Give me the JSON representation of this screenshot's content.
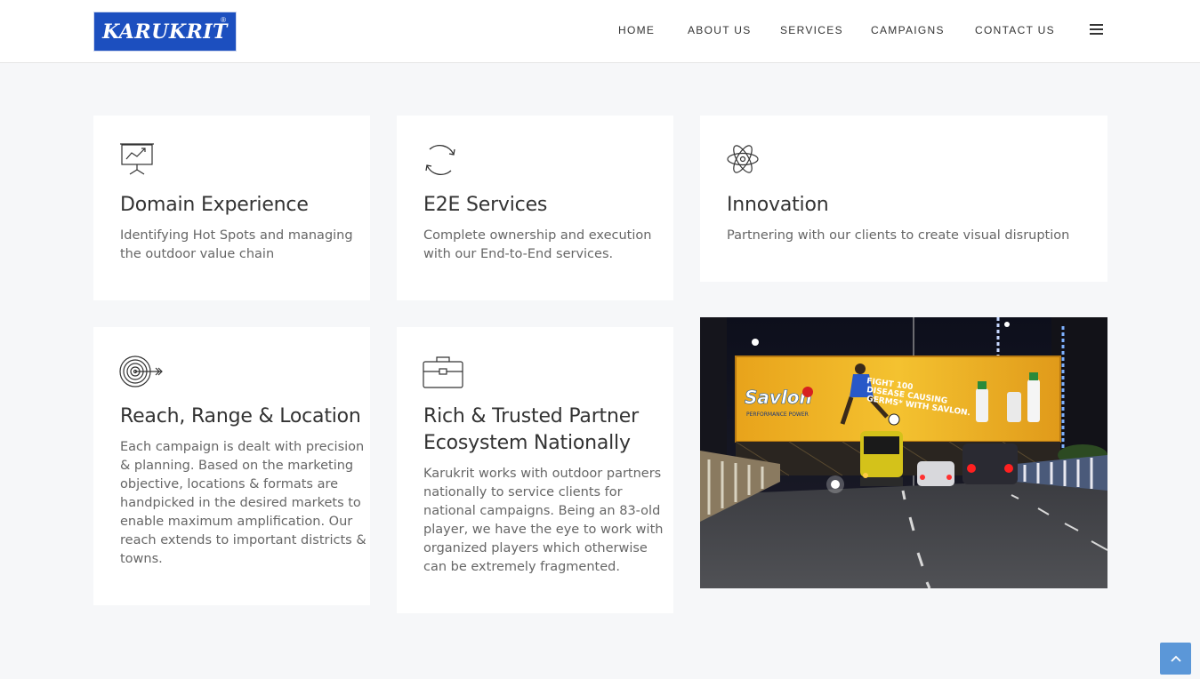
{
  "brand": {
    "logo_text": "KARUKRIT",
    "logo_mark": "®"
  },
  "nav": {
    "items": [
      {
        "label": "HOME"
      },
      {
        "label": "ABOUT US"
      },
      {
        "label": "SERVICES"
      },
      {
        "label": "CAMPAIGNS"
      },
      {
        "label": "CONTACT US"
      }
    ],
    "menu_icon": "hamburger-icon"
  },
  "cards": [
    {
      "icon": "presentation-chart-icon",
      "title": "Domain Experience",
      "text_lines": [
        "Identifying Hot Spots and managing",
        "the outdoor value chain"
      ]
    },
    {
      "icon": "refresh-cycle-icon",
      "title": "E2E Services",
      "text_lines": [
        "Complete ownership and execution",
        "with our End-to-End services."
      ]
    },
    {
      "icon": "atom-icon",
      "title": "Innovation",
      "text_lines": [
        "Partnering with our clients to create visual disruption"
      ]
    },
    {
      "icon": "target-arrow-icon",
      "title": "Reach, Range & Location",
      "text_lines": [
        "Each campaign is dealt with precision",
        "& planning. Based on the marketing",
        "objective, locations & formats are",
        "handpicked in the desired markets to",
        "enable maximum amplification. Our",
        "reach extends to important districts &",
        "towns."
      ]
    },
    {
      "icon": "briefcase-icon",
      "title_lines": [
        "Rich & Trusted Partner",
        "Ecosystem Nationally"
      ],
      "text_lines": [
        "Karukrit works with outdoor partners",
        "nationally to service clients for",
        "national campaigns. Being an 83-old",
        "player, we have the eye to work with",
        "organized players which otherwise",
        "can be extremely fragmented."
      ]
    }
  ],
  "billboard": {
    "brand": "Savlon",
    "headline_lines": [
      "FIGHT 100",
      "DISEASE CAUSING",
      "GERMS* WITH SAVLON."
    ],
    "tagline": "PERFORMANCE POWER"
  },
  "scroll_top_icon": "chevron-up-icon",
  "colors": {
    "logo_bg": "#1c4fbf",
    "scroll_btn": "#5b97d8",
    "page_bg": "#f6f7f9"
  }
}
